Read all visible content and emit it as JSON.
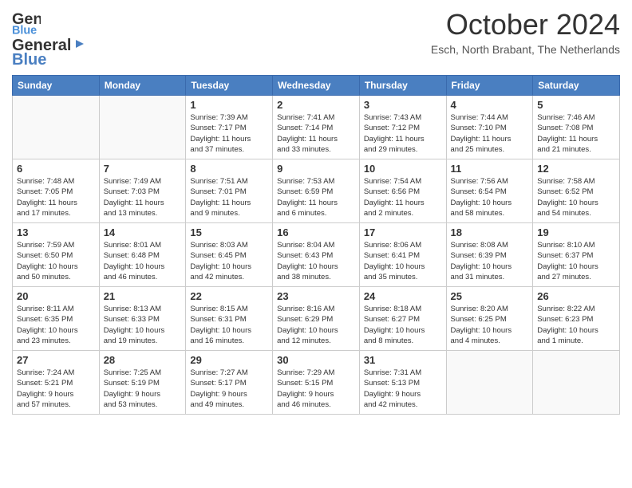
{
  "header": {
    "logo_general": "General",
    "logo_blue": "Blue",
    "month_title": "October 2024",
    "location": "Esch, North Brabant, The Netherlands"
  },
  "days_of_week": [
    "Sunday",
    "Monday",
    "Tuesday",
    "Wednesday",
    "Thursday",
    "Friday",
    "Saturday"
  ],
  "weeks": [
    [
      {
        "day": "",
        "info": ""
      },
      {
        "day": "",
        "info": ""
      },
      {
        "day": "1",
        "info": "Sunrise: 7:39 AM\nSunset: 7:17 PM\nDaylight: 11 hours\nand 37 minutes."
      },
      {
        "day": "2",
        "info": "Sunrise: 7:41 AM\nSunset: 7:14 PM\nDaylight: 11 hours\nand 33 minutes."
      },
      {
        "day": "3",
        "info": "Sunrise: 7:43 AM\nSunset: 7:12 PM\nDaylight: 11 hours\nand 29 minutes."
      },
      {
        "day": "4",
        "info": "Sunrise: 7:44 AM\nSunset: 7:10 PM\nDaylight: 11 hours\nand 25 minutes."
      },
      {
        "day": "5",
        "info": "Sunrise: 7:46 AM\nSunset: 7:08 PM\nDaylight: 11 hours\nand 21 minutes."
      }
    ],
    [
      {
        "day": "6",
        "info": "Sunrise: 7:48 AM\nSunset: 7:05 PM\nDaylight: 11 hours\nand 17 minutes."
      },
      {
        "day": "7",
        "info": "Sunrise: 7:49 AM\nSunset: 7:03 PM\nDaylight: 11 hours\nand 13 minutes."
      },
      {
        "day": "8",
        "info": "Sunrise: 7:51 AM\nSunset: 7:01 PM\nDaylight: 11 hours\nand 9 minutes."
      },
      {
        "day": "9",
        "info": "Sunrise: 7:53 AM\nSunset: 6:59 PM\nDaylight: 11 hours\nand 6 minutes."
      },
      {
        "day": "10",
        "info": "Sunrise: 7:54 AM\nSunset: 6:56 PM\nDaylight: 11 hours\nand 2 minutes."
      },
      {
        "day": "11",
        "info": "Sunrise: 7:56 AM\nSunset: 6:54 PM\nDaylight: 10 hours\nand 58 minutes."
      },
      {
        "day": "12",
        "info": "Sunrise: 7:58 AM\nSunset: 6:52 PM\nDaylight: 10 hours\nand 54 minutes."
      }
    ],
    [
      {
        "day": "13",
        "info": "Sunrise: 7:59 AM\nSunset: 6:50 PM\nDaylight: 10 hours\nand 50 minutes."
      },
      {
        "day": "14",
        "info": "Sunrise: 8:01 AM\nSunset: 6:48 PM\nDaylight: 10 hours\nand 46 minutes."
      },
      {
        "day": "15",
        "info": "Sunrise: 8:03 AM\nSunset: 6:45 PM\nDaylight: 10 hours\nand 42 minutes."
      },
      {
        "day": "16",
        "info": "Sunrise: 8:04 AM\nSunset: 6:43 PM\nDaylight: 10 hours\nand 38 minutes."
      },
      {
        "day": "17",
        "info": "Sunrise: 8:06 AM\nSunset: 6:41 PM\nDaylight: 10 hours\nand 35 minutes."
      },
      {
        "day": "18",
        "info": "Sunrise: 8:08 AM\nSunset: 6:39 PM\nDaylight: 10 hours\nand 31 minutes."
      },
      {
        "day": "19",
        "info": "Sunrise: 8:10 AM\nSunset: 6:37 PM\nDaylight: 10 hours\nand 27 minutes."
      }
    ],
    [
      {
        "day": "20",
        "info": "Sunrise: 8:11 AM\nSunset: 6:35 PM\nDaylight: 10 hours\nand 23 minutes."
      },
      {
        "day": "21",
        "info": "Sunrise: 8:13 AM\nSunset: 6:33 PM\nDaylight: 10 hours\nand 19 minutes."
      },
      {
        "day": "22",
        "info": "Sunrise: 8:15 AM\nSunset: 6:31 PM\nDaylight: 10 hours\nand 16 minutes."
      },
      {
        "day": "23",
        "info": "Sunrise: 8:16 AM\nSunset: 6:29 PM\nDaylight: 10 hours\nand 12 minutes."
      },
      {
        "day": "24",
        "info": "Sunrise: 8:18 AM\nSunset: 6:27 PM\nDaylight: 10 hours\nand 8 minutes."
      },
      {
        "day": "25",
        "info": "Sunrise: 8:20 AM\nSunset: 6:25 PM\nDaylight: 10 hours\nand 4 minutes."
      },
      {
        "day": "26",
        "info": "Sunrise: 8:22 AM\nSunset: 6:23 PM\nDaylight: 10 hours\nand 1 minute."
      }
    ],
    [
      {
        "day": "27",
        "info": "Sunrise: 7:24 AM\nSunset: 5:21 PM\nDaylight: 9 hours\nand 57 minutes."
      },
      {
        "day": "28",
        "info": "Sunrise: 7:25 AM\nSunset: 5:19 PM\nDaylight: 9 hours\nand 53 minutes."
      },
      {
        "day": "29",
        "info": "Sunrise: 7:27 AM\nSunset: 5:17 PM\nDaylight: 9 hours\nand 49 minutes."
      },
      {
        "day": "30",
        "info": "Sunrise: 7:29 AM\nSunset: 5:15 PM\nDaylight: 9 hours\nand 46 minutes."
      },
      {
        "day": "31",
        "info": "Sunrise: 7:31 AM\nSunset: 5:13 PM\nDaylight: 9 hours\nand 42 minutes."
      },
      {
        "day": "",
        "info": ""
      },
      {
        "day": "",
        "info": ""
      }
    ]
  ]
}
